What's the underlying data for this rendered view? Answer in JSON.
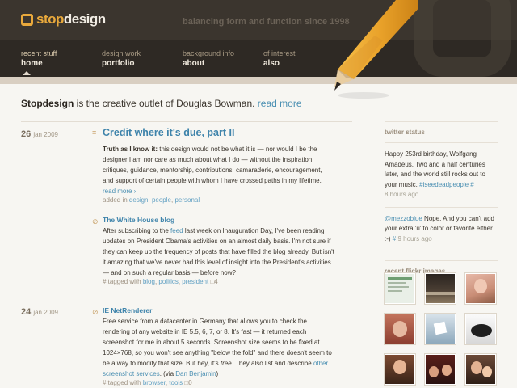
{
  "header": {
    "logo_prefix": "stop",
    "logo_suffix": "design",
    "tagline": "balancing form and function since 1998"
  },
  "nav": [
    {
      "sub": "recent stuff",
      "main": "home"
    },
    {
      "sub": "design work",
      "main": "portfolio"
    },
    {
      "sub": "background info",
      "main": "about"
    },
    {
      "sub": "of interest",
      "main": "also"
    }
  ],
  "intro": {
    "brand": "Stopdesign",
    "text": " is the creative outlet of Douglas Bowman. ",
    "link": "read more"
  },
  "posts": [
    {
      "day": "26",
      "month_year": "jan 2009",
      "title": "Credit where it's due, part II",
      "lead": "Truth as I know it:",
      "body": " this design would not be what it is — nor would I be the designer I am nor care as much about what I do — without the inspiration, critiques, guidance, mentorship, contributions, camaraderie, encouragement, and support of certain people with whom I have crossed paths in my lifetime.",
      "read_more": "read more ›",
      "meta_prefix": "added in ",
      "tags": [
        "design",
        "people",
        "personal"
      ]
    },
    {
      "title": "The White House blog",
      "body_1": "After subscribing to the ",
      "body_link": "feed",
      "body_2": " last week on Inauguration Day, I've been reading updates on President Obama's activities on an almost daily basis. I'm not sure if they can keep up the frequency of posts that have filled the blog already. But isn't it amazing that we've never had this level of insight into the President's activities — and on such a regular basis — before now?",
      "meta_prefix": "# tagged with ",
      "tags": [
        "blog",
        "politics",
        "president"
      ],
      "comments": "4"
    },
    {
      "day": "24",
      "month_year": "jan 2009",
      "title": "IE NetRenderer",
      "body_1": "Free service from a datacenter in Germany that allows you to check the rendering of any website in IE 5.5, 6, 7, or 8. It's fast — it returned each screenshot for me in about 5 seconds. Screenshot size seems to be fixed at 1024×768, so you won't see anything \"below the fold\" and there doesn't seem to be a way to modify that size. But hey, it's ",
      "body_em": "free",
      "body_2": ". They also list and describe ",
      "body_link": "other screenshot services",
      "body_3": ". (via ",
      "body_link2": "Dan Benjamin",
      "body_4": ")",
      "meta_prefix": "# tagged with ",
      "tags": [
        "browser",
        "tools"
      ],
      "comments": "0"
    }
  ],
  "sidebar": {
    "twitter_heading": "twitter status",
    "tweet1": "Happy 253rd birthday, Wolfgang Amadeus. Two and a half centuries later, and the world still rocks out to your music. ",
    "tweet1_tag": "#iseedeadpeople",
    "tweet1_hash": " #",
    "tweet1_time": "8 hours ago",
    "tweet2_user": "@mezzoblue",
    "tweet2": " Nope. And you can't add your extra 'u' to color or favorite either :-) ",
    "tweet2_hash": "#",
    "tweet2_time": " 9 hours ago",
    "flickr_heading": "recent flickr images"
  },
  "colors": {
    "accent": "#e9a93c",
    "link": "#3f84ab",
    "header_bg": "#2e2924"
  }
}
